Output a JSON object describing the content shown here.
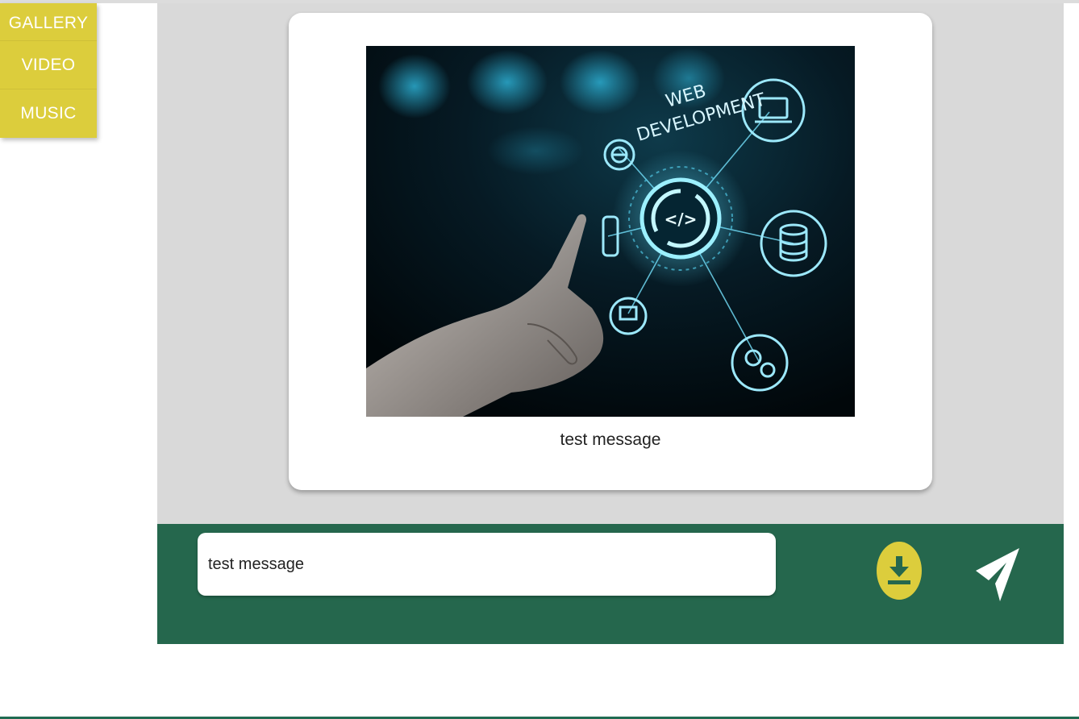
{
  "sidebar": {
    "items": [
      {
        "label": "GALLERY"
      },
      {
        "label": "VIDEO"
      },
      {
        "label": "MUSIC"
      }
    ]
  },
  "chat": {
    "messages": [
      {
        "image": {
          "headline_line1": "WEB",
          "headline_line2": "DEVELOPMENT",
          "center_glyph": "</>"
        },
        "caption": "test message"
      }
    ]
  },
  "composer": {
    "input_value": "test message",
    "download_icon": "download-icon",
    "send_icon": "send-icon"
  },
  "colors": {
    "accent": "#dccd3c",
    "composer_bg": "#25674d",
    "chat_bg": "#d9d9d9"
  }
}
